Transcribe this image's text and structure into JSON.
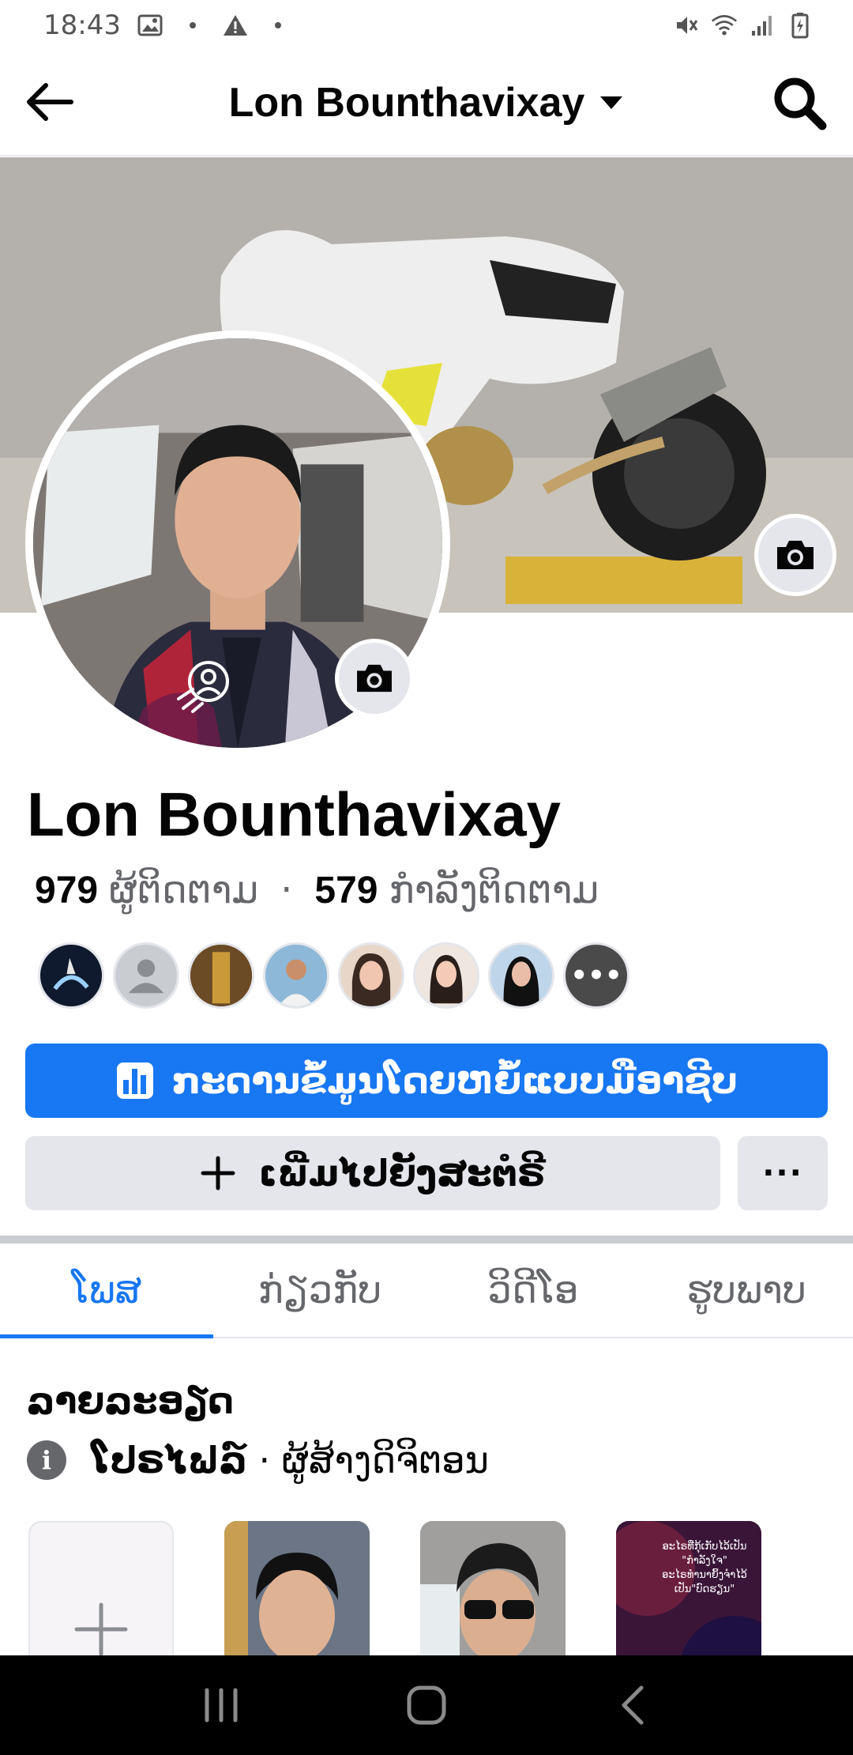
{
  "status_bar": {
    "time": "18:43",
    "icons": [
      "image-icon",
      "dot-icon",
      "warning-icon",
      "dot-icon",
      "mute-icon",
      "wifi-icon",
      "signal-icon",
      "battery-icon"
    ]
  },
  "app_bar": {
    "title": "Lon Bounthavixay",
    "back_icon": "arrow-left-icon",
    "dropdown_icon": "caret-down-icon",
    "search_icon": "search-icon"
  },
  "profile": {
    "name": "Lon Bounthavixay",
    "followers_count": "979",
    "followers_label": "ຜູ້ຕິດຕາມ",
    "separator": "·",
    "following_count": "579",
    "following_label": "ກຳລັງຕິດຕາມ"
  },
  "buttons": {
    "dashboard_label": "ກະດານຂໍ້ມູນໂດຍຫຍໍ້ແບບມືອາຊີບ",
    "add_story_label": "ເພີ່ມໄປຍັງສະຕໍຣີ",
    "more_label": "···"
  },
  "tabs": [
    {
      "label": "ໂພສ",
      "active": true
    },
    {
      "label": "ກ່ຽວກັບ",
      "active": false
    },
    {
      "label": "ວິດີໂອ",
      "active": false
    },
    {
      "label": "ຮູບພາບ",
      "active": false
    }
  ],
  "details": {
    "title": "ລາຍລະອຽດ",
    "type_label": "ໂປຣໄຟລ໌",
    "separator": "·",
    "category": "ຜູ້ສ້າງດິຈິຕອນ"
  },
  "follower_more": "•••",
  "featured_post": {
    "line1": "ອະໄຣທີ່ກຸ້ເກັບໄວ້ເປັນ",
    "line2": "\"ກຳລັງໃຈ\"",
    "line3": "ອະໄຣທຳນາຍິ້ງຈຳໄວ້",
    "line4": "ເປັນ\"ບົດຮຽນ\""
  },
  "colors": {
    "accent": "#1877f2",
    "secondary_button": "#e4e6eb",
    "text_primary": "#050505",
    "text_secondary": "#65676b",
    "nav_bar": "#000000"
  }
}
